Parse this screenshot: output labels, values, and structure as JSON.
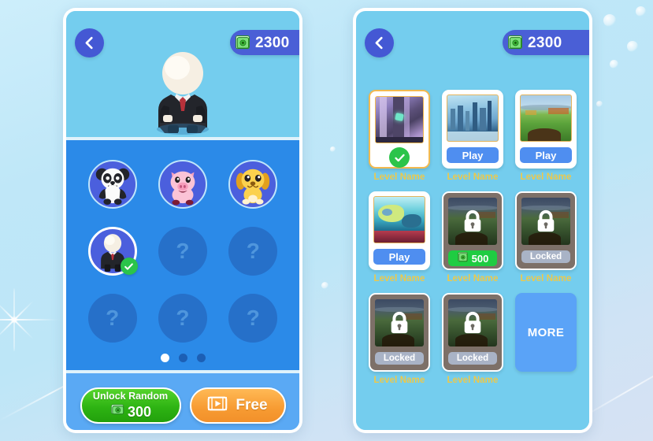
{
  "background": {
    "gradient_from": "#cdeefb",
    "gradient_to": "#d6e2f3"
  },
  "character_screen": {
    "back_icon": "chevron-left-icon",
    "currency": {
      "icon": "cash-icon",
      "amount": "2300"
    },
    "preview": {
      "character": "suit-character-avatar"
    },
    "characters": [
      {
        "id": "panda",
        "art": "panda",
        "state": "unlocked",
        "label": ""
      },
      {
        "id": "pig",
        "art": "pig",
        "state": "unlocked",
        "label": ""
      },
      {
        "id": "dog",
        "art": "dog",
        "state": "unlocked",
        "label": ""
      },
      {
        "id": "suit",
        "art": "suit",
        "state": "selected",
        "label": ""
      },
      {
        "id": "slot5",
        "art": "locked",
        "state": "locked",
        "label": "?"
      },
      {
        "id": "slot6",
        "art": "locked",
        "state": "locked",
        "label": "?"
      },
      {
        "id": "slot7",
        "art": "locked",
        "state": "locked",
        "label": "?"
      },
      {
        "id": "slot8",
        "art": "locked",
        "state": "locked",
        "label": "?"
      },
      {
        "id": "slot9",
        "art": "locked",
        "state": "locked",
        "label": "?"
      }
    ],
    "pagination": {
      "total": 3,
      "active_index": 0
    },
    "unlock_random_button": {
      "title": "Unlock Random",
      "price": "300",
      "icon": "cash-icon",
      "color": "#2eb413"
    },
    "free_button": {
      "label": "Free",
      "icon": "video-ad-icon",
      "color": "#f79b32"
    }
  },
  "level_screen": {
    "back_icon": "chevron-left-icon",
    "currency": {
      "icon": "cash-icon",
      "amount": "2300"
    },
    "levels": [
      {
        "state": "completed",
        "cta": "",
        "name": "Level Name",
        "thumb": "cave-crystal",
        "icon": "check-icon"
      },
      {
        "state": "open",
        "cta": "Play",
        "name": "Level Name",
        "thumb": "winter-city",
        "icon": ""
      },
      {
        "state": "open",
        "cta": "Play",
        "name": "Level Name",
        "thumb": "green-field",
        "icon": ""
      },
      {
        "state": "open",
        "cta": "Play",
        "name": "Level Name",
        "thumb": "underwater",
        "icon": ""
      },
      {
        "state": "locked",
        "cta": "500",
        "name": "Level Name",
        "thumb": "dark-landscape",
        "icon": "lock-icon"
      },
      {
        "state": "locked",
        "cta": "Locked",
        "name": "Level Name",
        "thumb": "dark-landscape",
        "icon": "lock-icon"
      },
      {
        "state": "locked",
        "cta": "Locked",
        "name": "Level Name",
        "thumb": "dark-landscape",
        "icon": "lock-icon"
      },
      {
        "state": "locked",
        "cta": "Locked",
        "name": "Level Name",
        "thumb": "dark-landscape",
        "icon": "lock-icon"
      }
    ],
    "more_button": {
      "label": "MORE",
      "color": "#5aa3f7"
    }
  }
}
